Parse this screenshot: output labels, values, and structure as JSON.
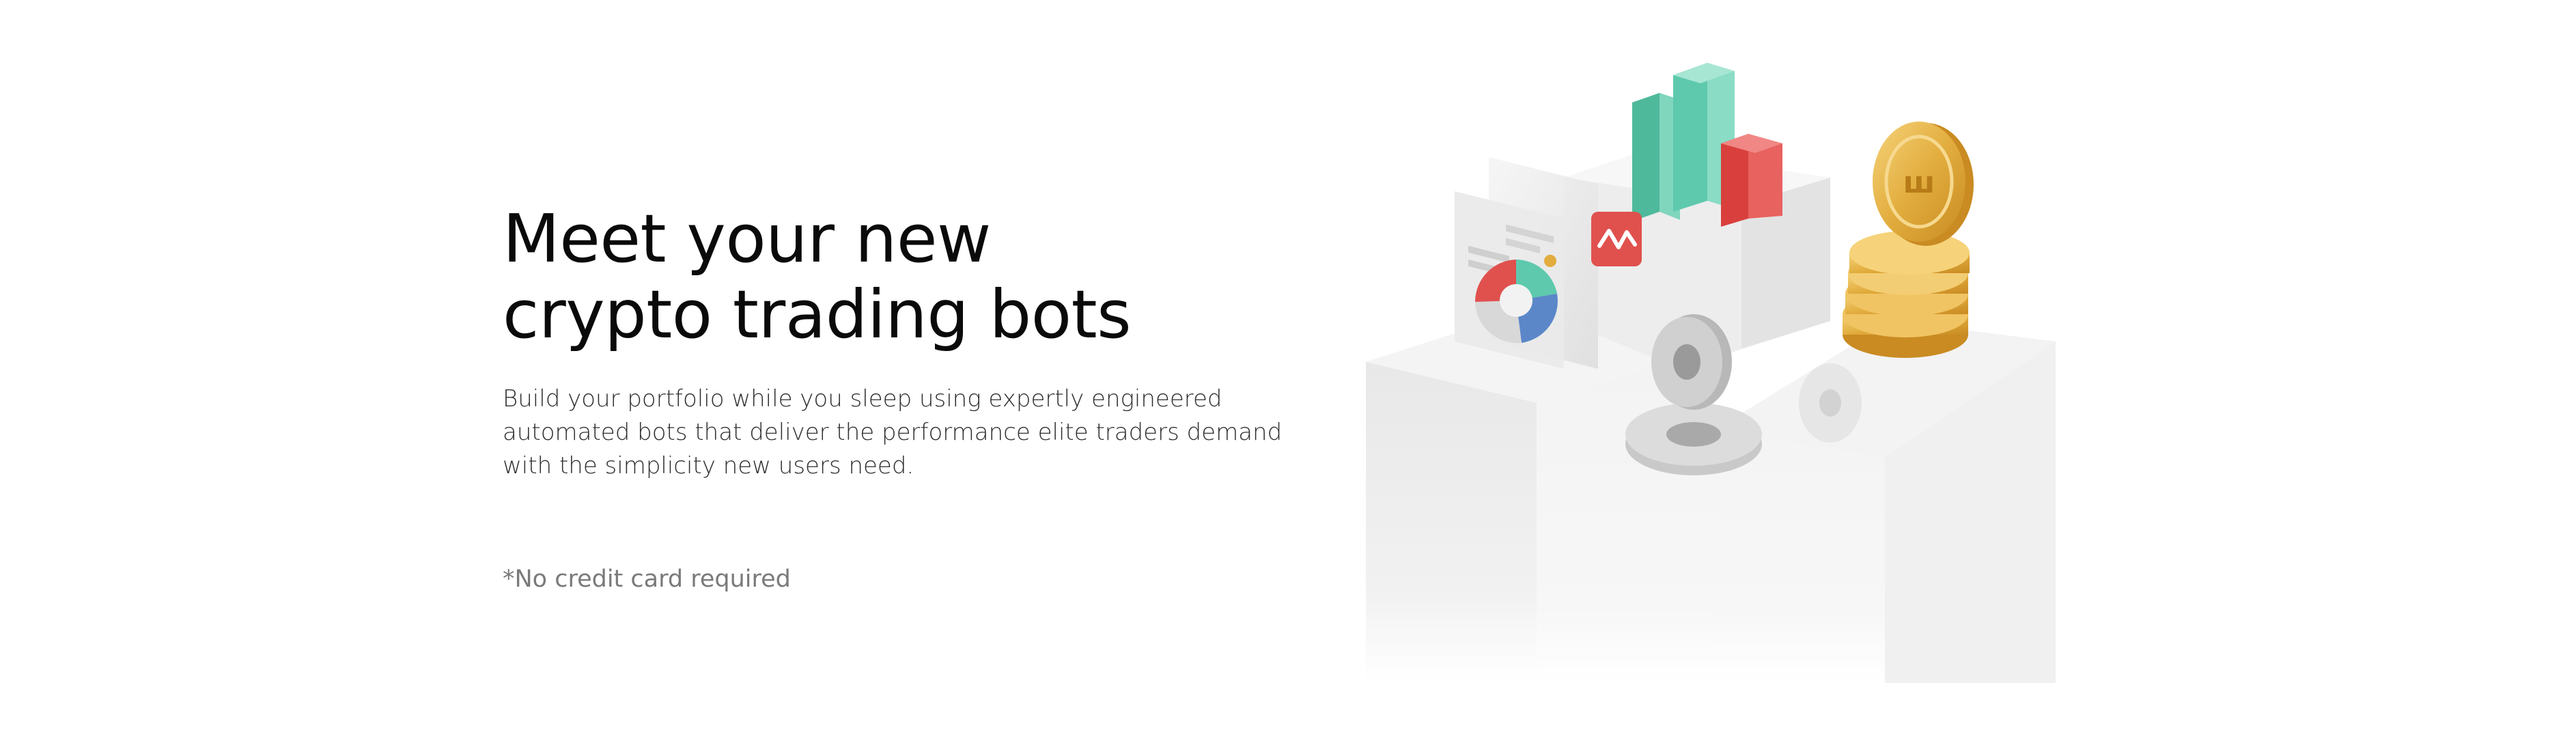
{
  "hero": {
    "title": "Meet your new crypto trading bots",
    "description": "Build your portfolio while you sleep using expertly engineered automated bots that deliver the performance elite traders demand with the simplicity new users need.",
    "note": "*No credit card required"
  },
  "illustration": {
    "icons": [
      "bar-chart-icon",
      "coins-icon",
      "gears-icon",
      "pie-chart-icon",
      "trend-badge-icon"
    ],
    "colors": {
      "green": "#5ec9ad",
      "red": "#e0514e",
      "gold": "#e2ad3e",
      "blue": "#5b87c9",
      "pedestal": "#ededed"
    }
  }
}
